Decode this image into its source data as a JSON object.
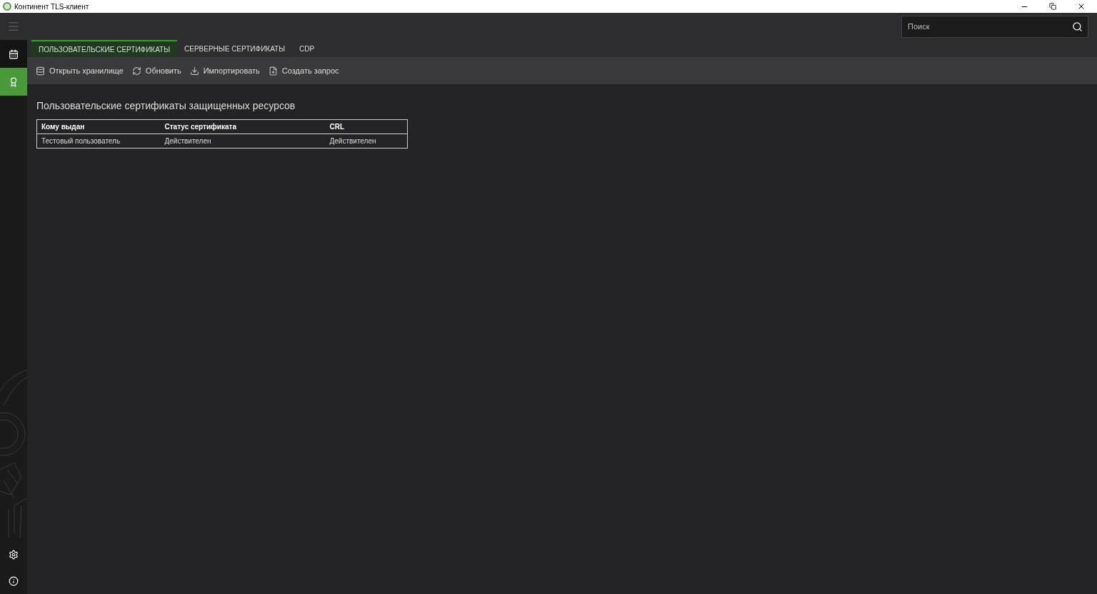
{
  "window": {
    "title": "Континент TLS-клиент"
  },
  "search": {
    "placeholder": "Поиск"
  },
  "sidebar": {
    "items": [
      {
        "kind": "calendar",
        "selected": false
      },
      {
        "kind": "certificate",
        "selected": true
      }
    ]
  },
  "tabs": [
    {
      "label": "ПОЛЬЗОВАТЕЛЬСКИЕ СЕРТИФИКАТЫ",
      "selected": true
    },
    {
      "label": "СЕРВЕРНЫЕ СЕРТИФИКАТЫ",
      "selected": false
    },
    {
      "label": "CDP",
      "selected": false
    }
  ],
  "toolbar": [
    {
      "kind": "storage",
      "label": "Открыть хранилище"
    },
    {
      "kind": "refresh",
      "label": "Обновить"
    },
    {
      "kind": "import",
      "label": "Импортировать"
    },
    {
      "kind": "request",
      "label": "Создать запрос"
    }
  ],
  "section_title": "Пользовательские сертификаты защищенных ресурсов",
  "table": {
    "columns": [
      "Кому выдан",
      "Статус сертификата",
      "CRL"
    ],
    "rows": [
      [
        "Тестовый пользователь",
        "Действителен",
        "Действителен"
      ]
    ]
  }
}
